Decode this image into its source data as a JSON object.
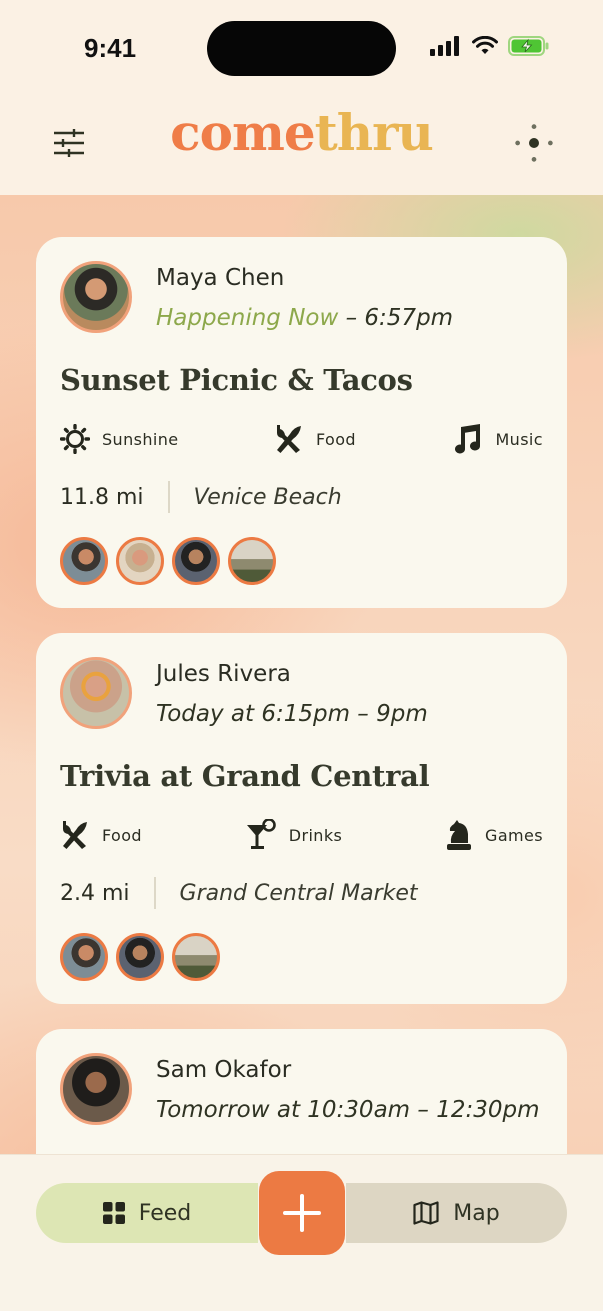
{
  "status_bar": {
    "time": "9:41"
  },
  "header": {
    "logo_part1": "come",
    "logo_part2": "thru",
    "filter_icon": "sliders-icon",
    "menu_icon": "dots-cross-icon"
  },
  "events": [
    {
      "host": "Maya Chen",
      "live_label": "Happening Now",
      "time_suffix": " – 6:57pm",
      "title": "Sunset Picnic & Tacos",
      "tags": [
        {
          "label": "Sunshine",
          "icon": "sun-icon"
        },
        {
          "label": "Food",
          "icon": "utensils-icon"
        },
        {
          "label": "Music",
          "icon": "music-note-icon"
        }
      ],
      "distance": "11.8 mi",
      "place": "Venice Beach",
      "attendee_count": 4
    },
    {
      "host": "Jules Rivera",
      "time": "Today at 6:15pm – 9pm",
      "title": "Trivia at Grand Central",
      "tags": [
        {
          "label": "Food",
          "icon": "utensils-icon"
        },
        {
          "label": "Drinks",
          "icon": "cocktail-icon"
        },
        {
          "label": "Games",
          "icon": "chess-knight-icon"
        }
      ],
      "distance": "2.4 mi",
      "place": "Grand Central Market",
      "attendee_count": 3
    },
    {
      "host": "Sam Okafor",
      "time": "Tomorrow at 10:30am – 12:30pm"
    }
  ],
  "tabbar": {
    "feed_label": "Feed",
    "map_label": "Map",
    "add_icon": "plus-icon"
  },
  "colors": {
    "accent": "#ec7a43",
    "live": "#8da84b",
    "feed_tab": "#dde6b4",
    "map_tab": "#ddd6c3",
    "card": "#faf8ee"
  }
}
